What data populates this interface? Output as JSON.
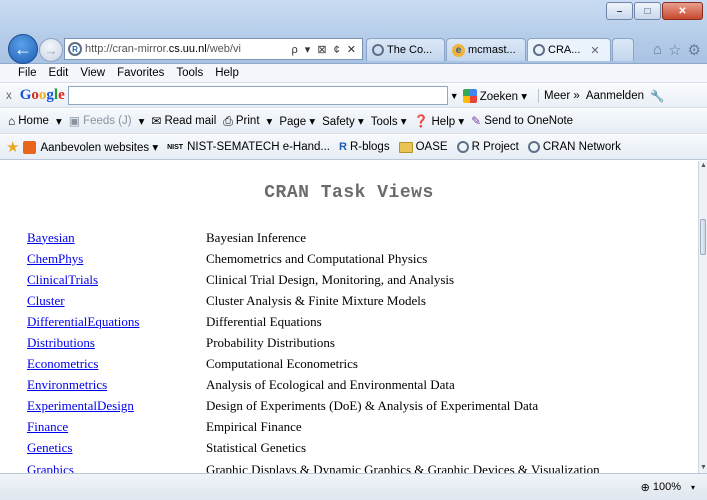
{
  "window": {
    "minimize": "–",
    "maximize": "□",
    "close": "✕"
  },
  "nav": {
    "address": {
      "prefix": "http://cran-mirror.",
      "domain": "cs.uu.nl",
      "suffix": "/web/vi",
      "tools": "ρ ▾ ⊠ ¢ ✕"
    }
  },
  "tabs": [
    {
      "label": "The Co...",
      "active": false
    },
    {
      "label": "mcmast...",
      "active": false
    },
    {
      "label": "CRA...",
      "active": true,
      "close": "✕"
    }
  ],
  "menu": [
    "File",
    "Edit",
    "View",
    "Favorites",
    "Tools",
    "Help"
  ],
  "google_toolbar": {
    "close": "x",
    "logo": "Google",
    "search_value": "",
    "zoeken": "Zoeken ▾",
    "meer": "Meer »",
    "aanmelden": "Aanmelden"
  },
  "command_bar": [
    {
      "label": "Home",
      "icon": "home-icon",
      "dim": false
    },
    {
      "label": "▾",
      "icon": "",
      "dim": false
    },
    {
      "label": "Feeds (J)",
      "icon": "feeds-icon",
      "dim": true
    },
    {
      "label": "▾",
      "icon": "",
      "dim": false
    },
    {
      "label": "Read mail",
      "icon": "mail-icon",
      "dim": false
    },
    {
      "label": "Print",
      "icon": "print-icon",
      "dim": false
    },
    {
      "label": "▾",
      "icon": "",
      "dim": false
    },
    {
      "label": "Page ▾",
      "icon": "",
      "dim": false
    },
    {
      "label": "Safety ▾",
      "icon": "",
      "dim": false
    },
    {
      "label": "Tools ▾",
      "icon": "",
      "dim": false
    },
    {
      "label": "Help ▾",
      "icon": "help-icon",
      "dim": false
    },
    {
      "label": "Send to OneNote",
      "icon": "onenote-icon",
      "dim": false
    }
  ],
  "favorites_bar": [
    {
      "label": "Aanbevolen websites ▾",
      "icon": "orange"
    },
    {
      "label": "NIST-SEMATECH e-Hand...",
      "icon": "nist"
    },
    {
      "label": "R-blogs",
      "icon": "r"
    },
    {
      "label": "OASE",
      "icon": "folder"
    },
    {
      "label": "R Project",
      "icon": "cran"
    },
    {
      "label": "CRAN Network",
      "icon": "cran"
    }
  ],
  "page": {
    "title": "CRAN Task Views",
    "rows": [
      {
        "name": "Bayesian",
        "desc": "Bayesian Inference"
      },
      {
        "name": "ChemPhys",
        "desc": "Chemometrics and Computational Physics"
      },
      {
        "name": "ClinicalTrials",
        "desc": "Clinical Trial Design, Monitoring, and Analysis"
      },
      {
        "name": "Cluster",
        "desc": "Cluster Analysis & Finite Mixture Models"
      },
      {
        "name": "DifferentialEquations",
        "desc": "Differential Equations"
      },
      {
        "name": "Distributions",
        "desc": "Probability Distributions"
      },
      {
        "name": "Econometrics",
        "desc": "Computational Econometrics"
      },
      {
        "name": "Environmetrics",
        "desc": "Analysis of Ecological and Environmental Data"
      },
      {
        "name": "ExperimentalDesign",
        "desc": "Design of Experiments (DoE) & Analysis of Experimental Data"
      },
      {
        "name": "Finance",
        "desc": "Empirical Finance"
      },
      {
        "name": "Genetics",
        "desc": "Statistical Genetics"
      },
      {
        "name": "Graphics",
        "desc": "Graphic Displays & Dynamic Graphics & Graphic Devices & Visualization"
      }
    ]
  },
  "status": {
    "zoom": "100%",
    "caret": "▾"
  },
  "colors": {
    "link": "#0000ee",
    "title_gray": "#6b6b6b",
    "chrome_blue": "#b6cde9"
  }
}
